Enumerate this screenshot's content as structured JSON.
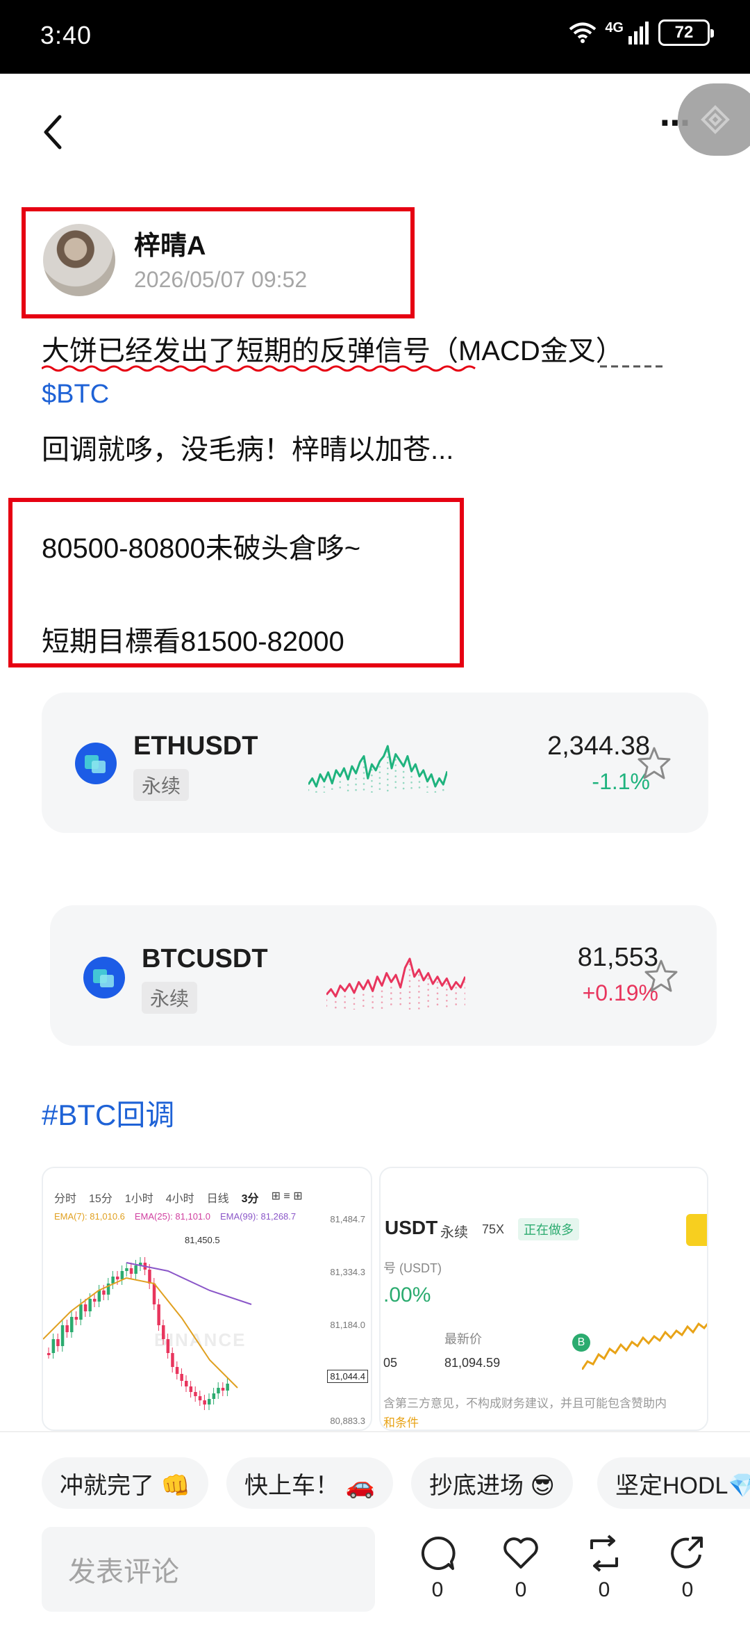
{
  "status_bar": {
    "time": "3:40",
    "network": "4G",
    "battery": "72"
  },
  "author": {
    "name": "梓晴A",
    "timestamp": "2026/05/07 09:52"
  },
  "post": {
    "line1": "大饼已经发出了短期的反弹信号（MACD金叉）",
    "ticker": "$BTC",
    "line2": "回调就哆，没毛病！梓晴以加苍...",
    "line3": "80500-80800未破头倉哆~",
    "line4": "短期目標看81500-82000"
  },
  "cards": [
    {
      "pair": "ETHUSDT",
      "tag": "永续",
      "price": "2,344.38",
      "change": "-1.1%",
      "change_color": "#1fb37e",
      "sparkline": [
        58,
        52,
        60,
        48,
        55,
        46,
        57,
        44,
        50,
        42,
        53,
        40,
        47,
        36,
        30,
        52,
        38,
        44,
        35,
        30,
        20,
        42,
        28,
        34,
        40,
        30,
        45,
        38,
        50,
        44,
        55,
        48,
        60,
        52,
        58,
        45
      ]
    },
    {
      "pair": "BTCUSDT",
      "tag": "永续",
      "price": "81,553",
      "change": "+0.19%",
      "change_color": "#e8355d",
      "sparkline": [
        50,
        44,
        52,
        40,
        46,
        38,
        48,
        36,
        44,
        34,
        46,
        30,
        40,
        26,
        36,
        28,
        42,
        20,
        10,
        30,
        22,
        34,
        26,
        38,
        30,
        40,
        32,
        44,
        36,
        42,
        30
      ]
    }
  ],
  "hashtag": "#BTC回调",
  "thumb1": {
    "tabs": [
      "分时",
      "15分",
      "1小时",
      "4小时",
      "日线",
      "3分"
    ],
    "ema": [
      "EMA(7): 81,010.6",
      "EMA(25): 81,101.0",
      "EMA(99): 81,268.7"
    ],
    "prices": [
      "81,484.7",
      "81,334.3",
      "81,184.0",
      "81,044.4",
      "80,883.3"
    ],
    "peak": "81,450.5",
    "watermark": "BINANCE"
  },
  "thumb2": {
    "pair": "USDT",
    "tag": "永续",
    "leverage": "75X",
    "status": "正在做多",
    "label": "号 (USDT)",
    "pct": ".00%",
    "last_label": "最新价",
    "left_val": "05",
    "last_price": "81,094.59",
    "disclaimer": "含第三方意见，不构成财务建议，并且可能包含赞助内",
    "terms": "和条件"
  },
  "chips": [
    "冲就完了 👊",
    "快上车！ 🚗",
    "抄底进场 😎",
    "坚定HODL💎"
  ],
  "comment_placeholder": "发表评论",
  "actions": [
    {
      "name": "comment",
      "count": "0"
    },
    {
      "name": "like",
      "count": "0"
    },
    {
      "name": "repost",
      "count": "0"
    },
    {
      "name": "share",
      "count": "0"
    }
  ]
}
